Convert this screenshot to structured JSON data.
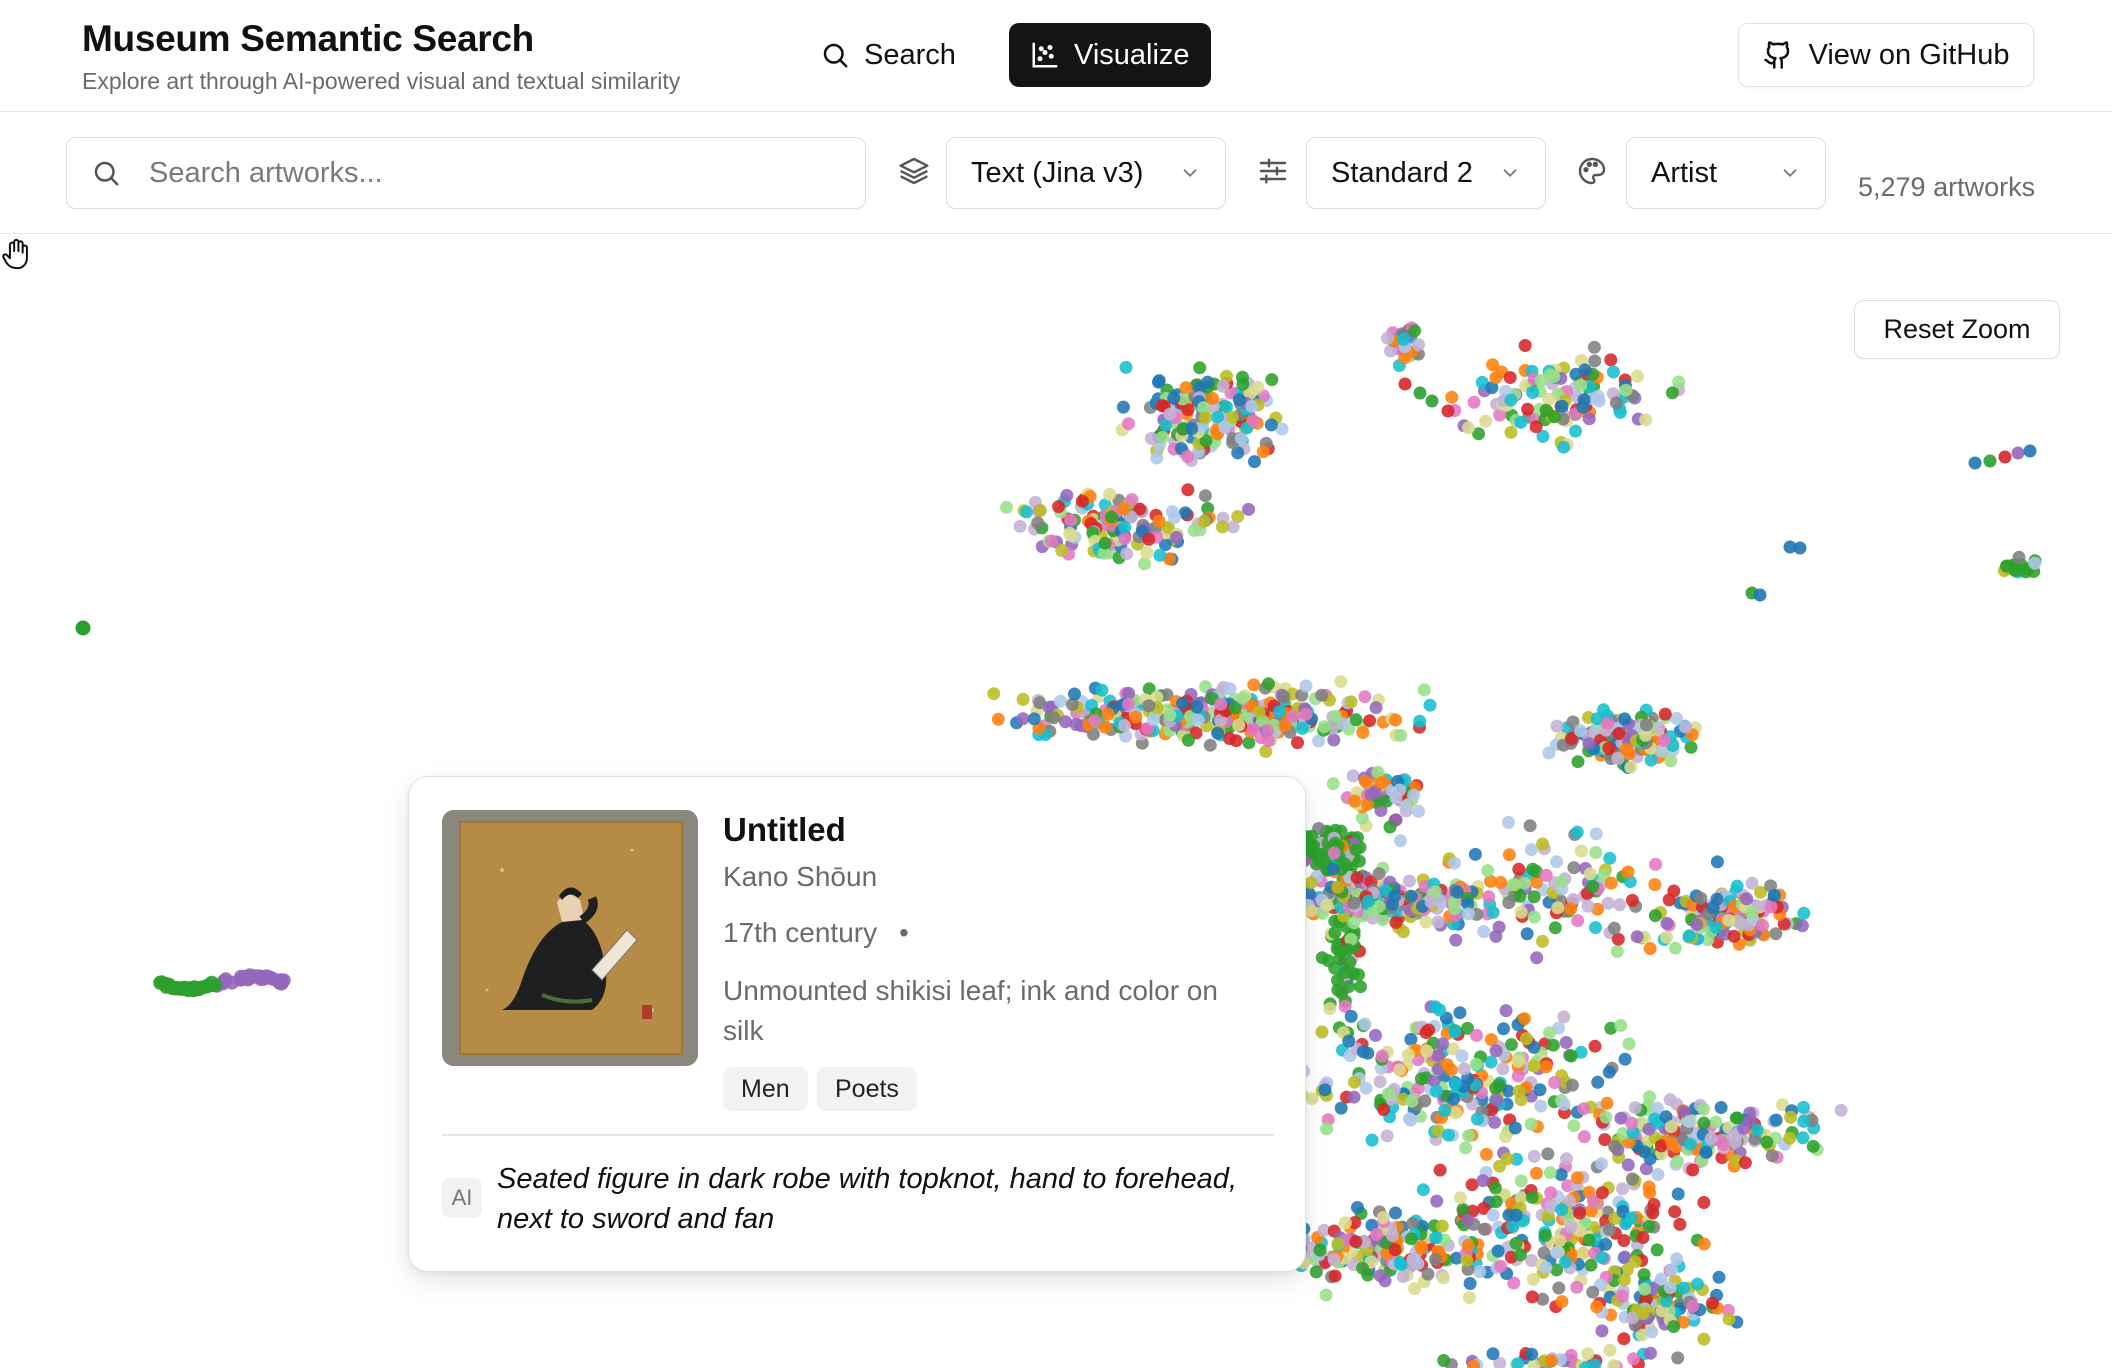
{
  "header": {
    "title": "Museum Semantic Search",
    "subtitle": "Explore art through AI-powered visual and textual similarity",
    "nav": {
      "search_label": "Search",
      "visualize_label": "Visualize"
    },
    "github_label": "View on GitHub"
  },
  "toolbar": {
    "search_placeholder": "Search artworks...",
    "embedding_model": "Text (Jina v3)",
    "projection": "Standard 2",
    "color_by": "Artist",
    "artwork_count": "5,279 artworks"
  },
  "viz": {
    "reset_zoom_label": "Reset Zoom",
    "palette": [
      "#2ca02c",
      "#9467bd",
      "#1f77b4",
      "#d62728",
      "#ff7f0e",
      "#bcbd22",
      "#e377c2",
      "#17becf",
      "#7f7f7f",
      "#dbdb8d",
      "#98df8a",
      "#c5b0d5",
      "#aec7e8"
    ]
  },
  "tooltip": {
    "title": "Untitled",
    "artist": "Kano Shōun",
    "date": "17th century",
    "separator": "•",
    "medium": "Unmounted shikisi leaf; ink and color on silk",
    "tags": [
      "Men",
      "Poets"
    ],
    "ai_badge": "AI",
    "ai_caption": "Seated figure in dark robe with topknot, hand to forehead, next to sword and fan"
  }
}
